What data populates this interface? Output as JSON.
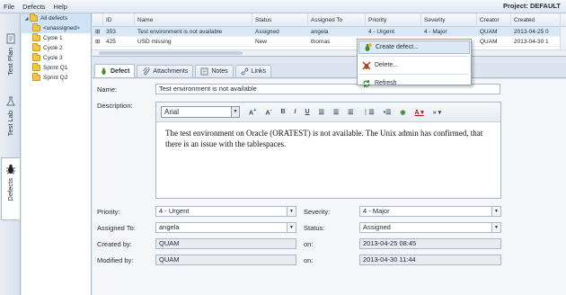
{
  "menubar": {
    "items": [
      "File",
      "Defects",
      "Help"
    ],
    "project": "Project: DEFAULT"
  },
  "lefttabs": [
    "Test Plan",
    "Test Lab",
    "Defects"
  ],
  "tree": {
    "root": "All defects",
    "children": [
      "<unassigned>",
      "Cycle 1",
      "Cycle 2",
      "Cycle 3",
      "Sprint Q1",
      "Sprint Q2"
    ]
  },
  "grid": {
    "columns": [
      "ID",
      "Name",
      "Status",
      "Assigned To",
      "Priority",
      "Severity",
      "Creator",
      "Created"
    ],
    "rows": [
      {
        "id": "353",
        "name": "Test environment is not available",
        "status": "Assigned",
        "assigned": "angela",
        "priority": "4 - Urgent",
        "severity": "4 - Major",
        "creator": "QUAM",
        "created": "2013-04-25 0"
      },
      {
        "id": "425",
        "name": "USD missing",
        "status": "New",
        "assigned": "thomas",
        "priority": "",
        "severity": "",
        "creator": "QUAM",
        "created": "2013-04-30 1"
      }
    ]
  },
  "context_menu": {
    "items": [
      "Create defect...",
      "Delete...",
      "Refresh"
    ]
  },
  "tabs": [
    "Defect",
    "Attachments",
    "Notes",
    "Links"
  ],
  "form": {
    "name_label": "Name:",
    "name_value": "Test environment is not available",
    "description_label": "Description:",
    "font": "Arial",
    "description_text": "The test environment on Oracle (ORATEST) is not available. The Unix admin has confirmed, that there is an issue with the tablespaces.",
    "priority_label": "Priority:",
    "priority_value": "4 - Urgent",
    "severity_label": "Severity:",
    "severity_value": "4 - Major",
    "assigned_label": "Assigned To:",
    "assigned_value": "angela",
    "status_label": "Status:",
    "status_value": "Assigned",
    "created_by_label": "Created by:",
    "created_by_value": "QUAM",
    "on_label": "on:",
    "created_on_value": "2013-04-25 08:45",
    "modified_by_label": "Modified by:",
    "modified_by_value": "QUAM",
    "modified_on_value": "2013-04-30 11:44"
  }
}
